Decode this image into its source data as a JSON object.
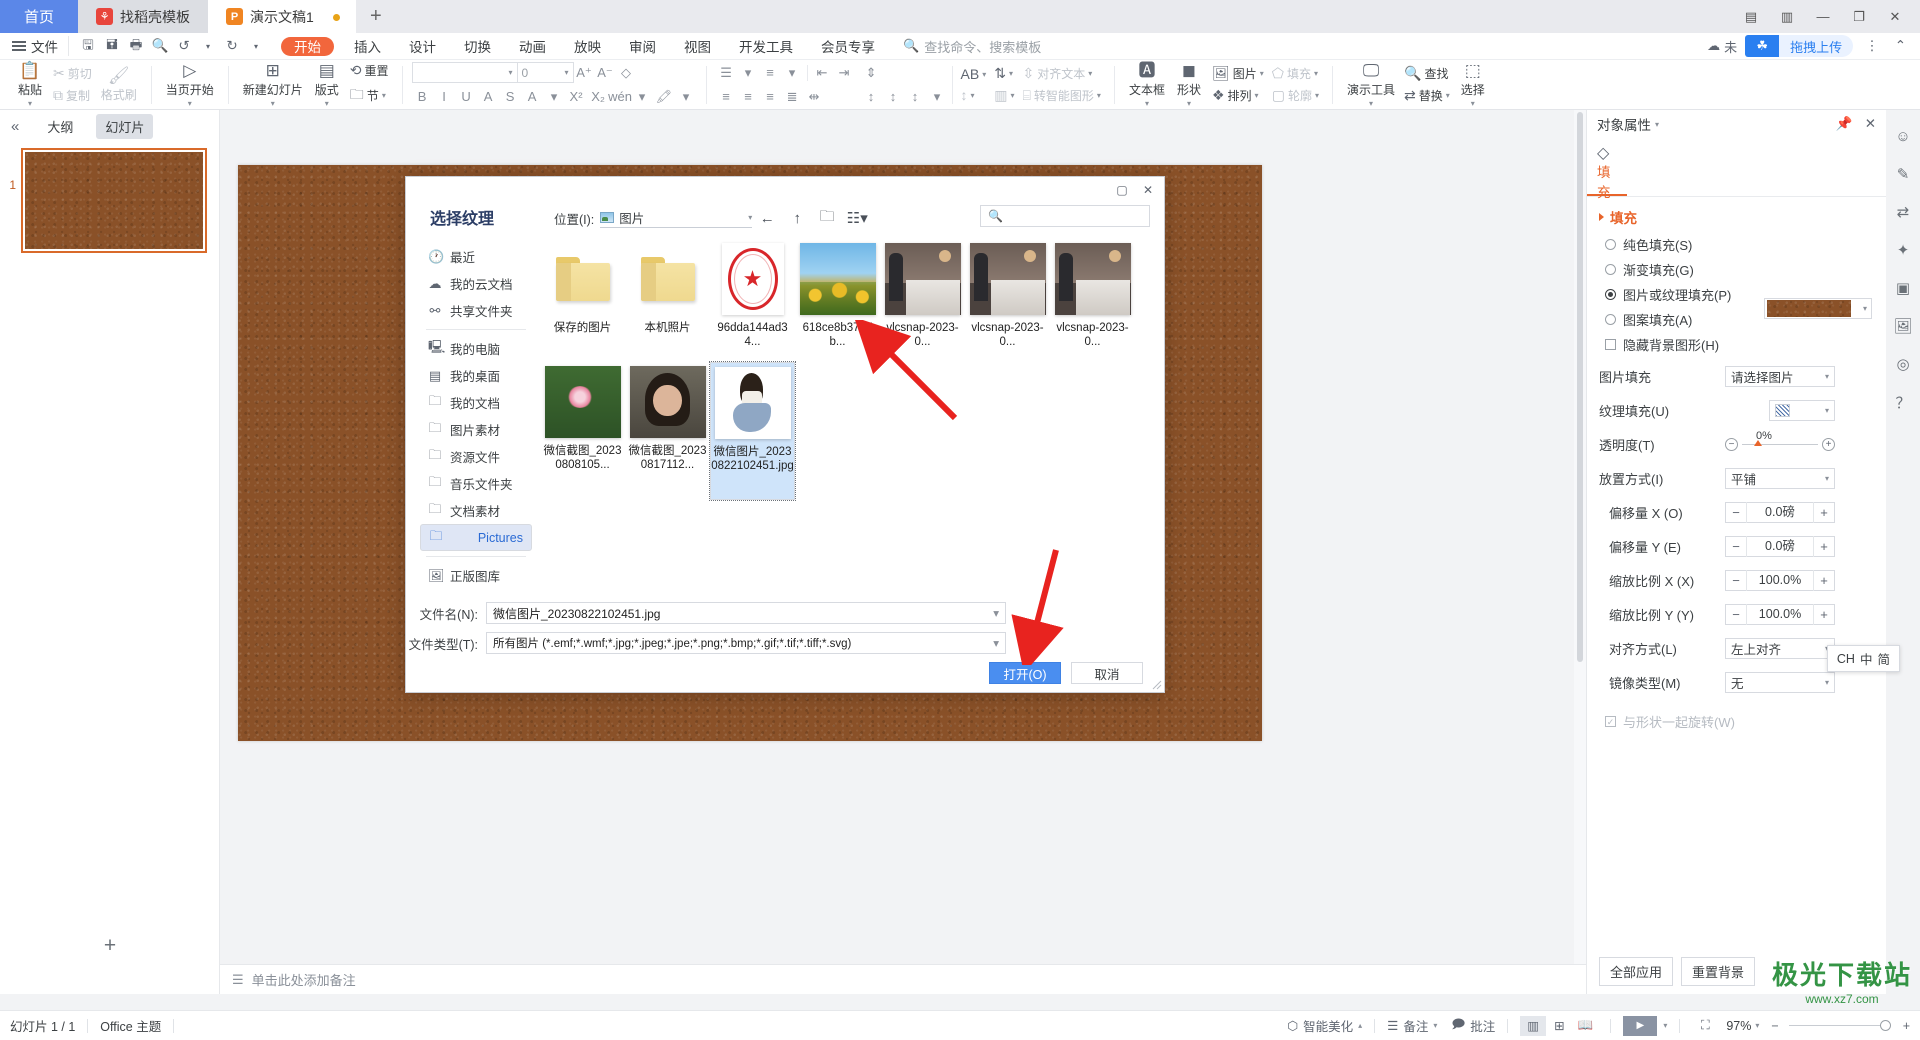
{
  "window": {
    "tabs": [
      {
        "label": "首页",
        "icon": "home-tab"
      },
      {
        "label": "找稻壳模板",
        "icon": "docer-icon"
      },
      {
        "label": "演示文稿1",
        "icon": "wpp-icon"
      }
    ],
    "add_tab": "+",
    "controls": {
      "minimize": "—",
      "maximize": "▢",
      "close": "✕",
      "restore": "❐"
    }
  },
  "menubar": {
    "file": "文件",
    "quick_access": [
      "save-icon",
      "save-as-icon",
      "print-icon",
      "print-preview-icon",
      "undo-icon",
      "redo-icon",
      "customize-icon"
    ],
    "tabs": [
      "开始",
      "插入",
      "设计",
      "切换",
      "动画",
      "放映",
      "审阅",
      "视图",
      "开发工具",
      "会员专享"
    ],
    "active_tab": "开始",
    "search_placeholder": "查找命令、搜索模板",
    "cloud_status": "未",
    "upload_label": "拖拽上传",
    "more": "⋮",
    "collapse": "⌃"
  },
  "ribbon": {
    "clipboard": {
      "paste": "粘贴",
      "cut": "剪切",
      "copy": "复制",
      "format_painter": "格式刷"
    },
    "present": {
      "start_here": "当页开始"
    },
    "slides": {
      "new_slide": "新建幻灯片",
      "layout": "版式",
      "reset": "重置",
      "section": "节"
    },
    "font": {
      "name": "",
      "size": "0",
      "grow": "A⁺",
      "shrink": "A⁻",
      "clear_format": "clear-format-icon",
      "bold": "B",
      "italic": "I",
      "underline": "U",
      "char_border": "A",
      "strikethrough": "S",
      "font_color": "A",
      "superscript": "X²",
      "subscript": "X₂",
      "phonetic": "wén",
      "highlight": "highlight-icon"
    },
    "paragraph": {
      "bullets": "bullet-list-icon",
      "numbering": "numbered-list-icon",
      "decrease_indent": "decrease-indent-icon",
      "increase_indent": "increase-indent-icon",
      "align_left": "align-left-icon",
      "align_center": "align-center-icon",
      "align_right": "align-right-icon",
      "justify": "justify-icon",
      "distribute": "distribute-icon",
      "line_spacing_group": "line-spacing-icon",
      "char_spacing": "AB",
      "sort": "sort-icon",
      "align_text": "对齐文本",
      "smartart": "转智能图形"
    },
    "insert": {
      "text_box": "文本框",
      "shape": "形状",
      "picture": "图片",
      "arrange": "排列",
      "fill": "填充",
      "outline": "轮廓"
    },
    "tools": {
      "present_tools": "演示工具",
      "find": "查找",
      "replace": "替换",
      "select": "选择"
    }
  },
  "leftpane": {
    "collapse": "«",
    "tabs": [
      "大纲",
      "幻灯片"
    ],
    "active_tab": "幻灯片",
    "thumbnails": [
      {
        "number": "1"
      }
    ],
    "add_slide": "+"
  },
  "canvas": {
    "notes_placeholder": "单击此处添加备注"
  },
  "dialog": {
    "title": "选择纹理",
    "location_label": "位置(I):",
    "location_value": "图片",
    "nav": {
      "back": "←",
      "up": "↑",
      "new_folder": "new-folder-icon",
      "view": "view-mode-icon"
    },
    "search_placeholder": "",
    "sidebar": [
      {
        "label": "最近",
        "icon": "clock-icon"
      },
      {
        "label": "我的云文档",
        "icon": "cloud-icon"
      },
      {
        "label": "共享文件夹",
        "icon": "share-icon"
      },
      {
        "label": "我的电脑",
        "icon": "computer-icon"
      },
      {
        "label": "我的桌面",
        "icon": "desktop-icon"
      },
      {
        "label": "我的文档",
        "icon": "folder-icon"
      },
      {
        "label": "图片素材",
        "icon": "folder-icon"
      },
      {
        "label": "资源文件",
        "icon": "folder-icon"
      },
      {
        "label": "音乐文件夹",
        "icon": "folder-icon"
      },
      {
        "label": "文档素材",
        "icon": "folder-icon"
      },
      {
        "label": "Pictures",
        "icon": "folder-icon",
        "selected": true
      },
      {
        "label": "正版图库",
        "icon": "gallery-icon"
      }
    ],
    "files": [
      {
        "name": "保存的图片",
        "kind": "folder"
      },
      {
        "name": "本机照片",
        "kind": "folder"
      },
      {
        "name": "96dda144ad34...",
        "kind": "stamp"
      },
      {
        "name": "618ce8b3797b...",
        "kind": "tulip"
      },
      {
        "name": "vlcsnap-2023-0...",
        "kind": "room"
      },
      {
        "name": "vlcsnap-2023-0...",
        "kind": "room"
      },
      {
        "name": "vlcsnap-2023-0...",
        "kind": "room"
      },
      {
        "name": "微信截图_20230808105...",
        "kind": "lotus"
      },
      {
        "name": "微信截图_20230817112...",
        "kind": "portrait"
      },
      {
        "name": "微信图片_20230822102451.jpg",
        "kind": "girl",
        "selected": true
      }
    ],
    "filename_label": "文件名(N):",
    "filename_value": "微信图片_20230822102451.jpg",
    "filetype_label": "文件类型(T):",
    "filetype_value": "所有图片 (*.emf;*.wmf;*.jpg;*.jpeg;*.jpe;*.png;*.bmp;*.gif;*.tif;*.tiff;*.svg)",
    "open_button": "打开(O)",
    "cancel_button": "取消"
  },
  "properties": {
    "header": "对象属性",
    "pin": "pin-icon",
    "close": "✕",
    "tab": "填充",
    "section": "填充",
    "fill_options": [
      {
        "label": "纯色填充(S)",
        "selected": false
      },
      {
        "label": "渐变填充(G)",
        "selected": false
      },
      {
        "label": "图片或纹理填充(P)",
        "selected": true
      },
      {
        "label": "图案填充(A)",
        "selected": false
      }
    ],
    "hide_bg_label": "隐藏背景图形(H)",
    "rows": [
      {
        "label": "图片填充",
        "type": "select",
        "value": "请选择图片"
      },
      {
        "label": "纹理填充(U)",
        "type": "texture",
        "value": ""
      },
      {
        "label": "透明度(T)",
        "type": "slider",
        "value": "0%"
      },
      {
        "label": "放置方式(I)",
        "type": "select",
        "value": "平铺"
      },
      {
        "label": "偏移量 X (O)",
        "type": "spin",
        "value": "0.0磅",
        "indent": true
      },
      {
        "label": "偏移量 Y (E)",
        "type": "spin",
        "value": "0.0磅",
        "indent": true
      },
      {
        "label": "缩放比例 X (X)",
        "type": "spin",
        "value": "100.0%",
        "indent": true
      },
      {
        "label": "缩放比例 Y (Y)",
        "type": "spin",
        "value": "100.0%",
        "indent": true
      },
      {
        "label": "对齐方式(L)",
        "type": "select",
        "value": "左上对齐",
        "indent": true
      },
      {
        "label": "镜像类型(M)",
        "type": "select",
        "value": "无",
        "indent": true
      }
    ],
    "rotate_with_shape": "与形状一起旋转(W)",
    "apply_all": "全部应用",
    "reset_bg": "重置背景"
  },
  "ime": {
    "label": "CH",
    "mode": "中",
    "variant": "简"
  },
  "statusbar": {
    "slide_count": "幻灯片 1 / 1",
    "theme": "Office 主题",
    "beautify": "智能美化",
    "notes": "备注",
    "comments": "批注",
    "views": [
      "normal-view-icon",
      "sorter-view-icon",
      "reading-view-icon"
    ],
    "play": "▶",
    "fit": "fit-icon",
    "zoom": "97%",
    "zoom_out": "−",
    "zoom_in": "+"
  },
  "watermark": {
    "line1": "极光下载站",
    "line2": "www.xz7.com"
  }
}
